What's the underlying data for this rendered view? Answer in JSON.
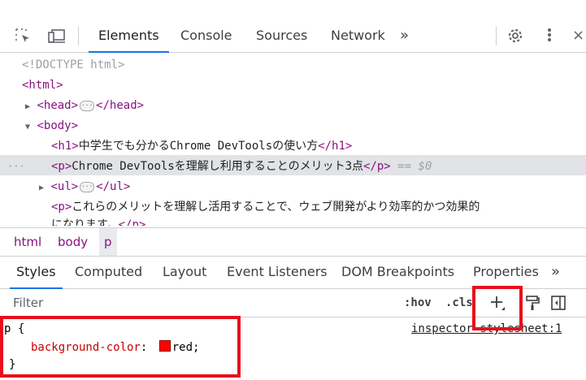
{
  "toolbar": {
    "tabs": [
      "Elements",
      "Console",
      "Sources",
      "Network"
    ],
    "more_tabs": "»",
    "inspect_icon": "inspect-element-icon",
    "device_icon": "device-toggle-icon",
    "settings_icon": "gear-icon",
    "menu_icon": "kebab-menu-icon",
    "close": "×"
  },
  "dom": {
    "doctype": "<!DOCTYPE html>",
    "html_open": "<html>",
    "head_open": "<head>",
    "head_close": "</head>",
    "body_open": "<body>",
    "h1_open": "<h1>",
    "h1_text": "中学生でも分かるChrome DevToolsの使い方",
    "h1_close": "</h1>",
    "p_open": "<p>",
    "p_text": "Chrome DevToolsを理解し利用することのメリット3点",
    "p_close": "</p>",
    "selected_suffix": "== $0",
    "row_dots": "···",
    "ul_open": "<ul>",
    "ul_close": "</ul>",
    "p2_open": "<p>",
    "p2_text": "これらのメリットを理解し活用することで、ウェブ開発がより効率的かつ効果的",
    "p2_text_wrap": "になります。",
    "p2_close": "</p>",
    "ellipsis": "···"
  },
  "breadcrumb": [
    "html",
    "body",
    "p"
  ],
  "styles_tabs": [
    "Styles",
    "Computed",
    "Layout",
    "Event Listeners",
    "DOM Breakpoints",
    "Properties"
  ],
  "styles_more": "»",
  "filter": {
    "placeholder": "Filter",
    "hov": ":hov",
    "cls": ".cls",
    "add_icon": "plus-icon",
    "paint_icon": "paint-roller-icon",
    "sidebar_icon": "toggle-sidebar-icon"
  },
  "rule": {
    "selector": "p {",
    "source": "inspector-stylesheet:1",
    "property": "background-color",
    "colon": ":",
    "value": "red",
    "semicolon": ";",
    "close": "}",
    "swatch_color": "#ff0000"
  },
  "colors": {
    "highlight_box": "#e8101b",
    "tab_underline": "#1a73e8",
    "tag": "#881280"
  }
}
